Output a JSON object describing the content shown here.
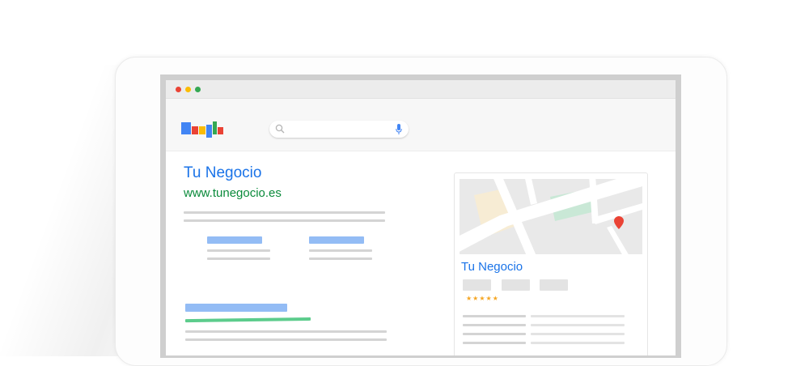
{
  "window": {
    "controls": [
      {
        "name": "close",
        "color": "#ea4335"
      },
      {
        "name": "minimize",
        "color": "#fbbc05"
      },
      {
        "name": "maximize",
        "color": "#34a853"
      }
    ]
  },
  "header": {
    "logo_colors": [
      "#4285f4",
      "#ea4335",
      "#fbbc05",
      "#4285f4",
      "#34a853",
      "#ea4335"
    ],
    "search": {
      "value": "",
      "icon": "search-icon",
      "voice_icon": "mic-icon"
    }
  },
  "result": {
    "title": "Tu Negocio",
    "url": "www.tunegocio.es"
  },
  "knowledge_panel": {
    "map_pin_color": "#ea4335",
    "title": "Tu Negocio",
    "rating_stars": "★★★★★",
    "rating": 5
  },
  "colors": {
    "link": "#1a73e8",
    "url": "#0a8a3a",
    "placeholder_blue": "#93bcf5",
    "placeholder_green": "#5ccc8c"
  }
}
